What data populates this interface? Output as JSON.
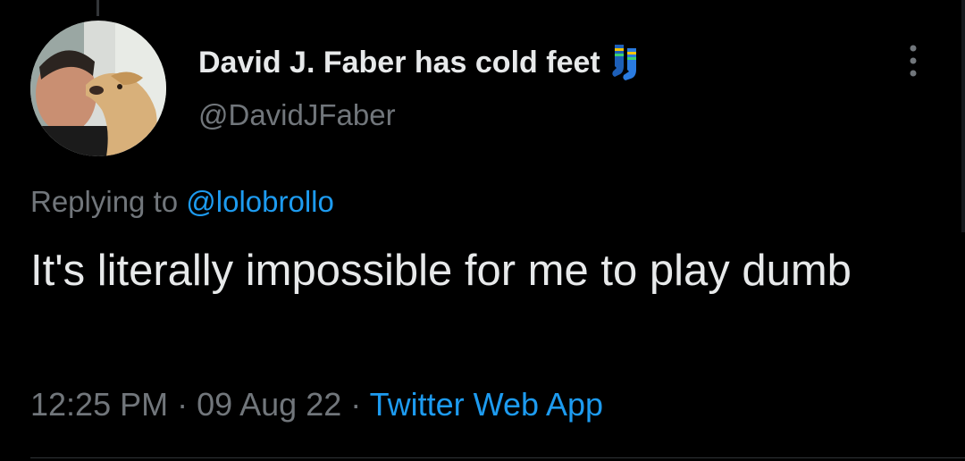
{
  "author": {
    "display_name": "David J. Faber has cold feet",
    "handle": "@DavidJFaber",
    "name_emoji": "socks-icon"
  },
  "reply": {
    "prefix": "Replying to ",
    "mention": "@lolobrollo"
  },
  "tweet": {
    "text": "It's literally impossible for me to play dumb"
  },
  "meta": {
    "time": "12:25 PM",
    "separator": " · ",
    "date": "09 Aug 22",
    "source": "Twitter Web App"
  },
  "colors": {
    "background": "#000000",
    "primary_text": "#e7e9ea",
    "secondary_text": "#71767b",
    "link": "#1d9bf0"
  }
}
